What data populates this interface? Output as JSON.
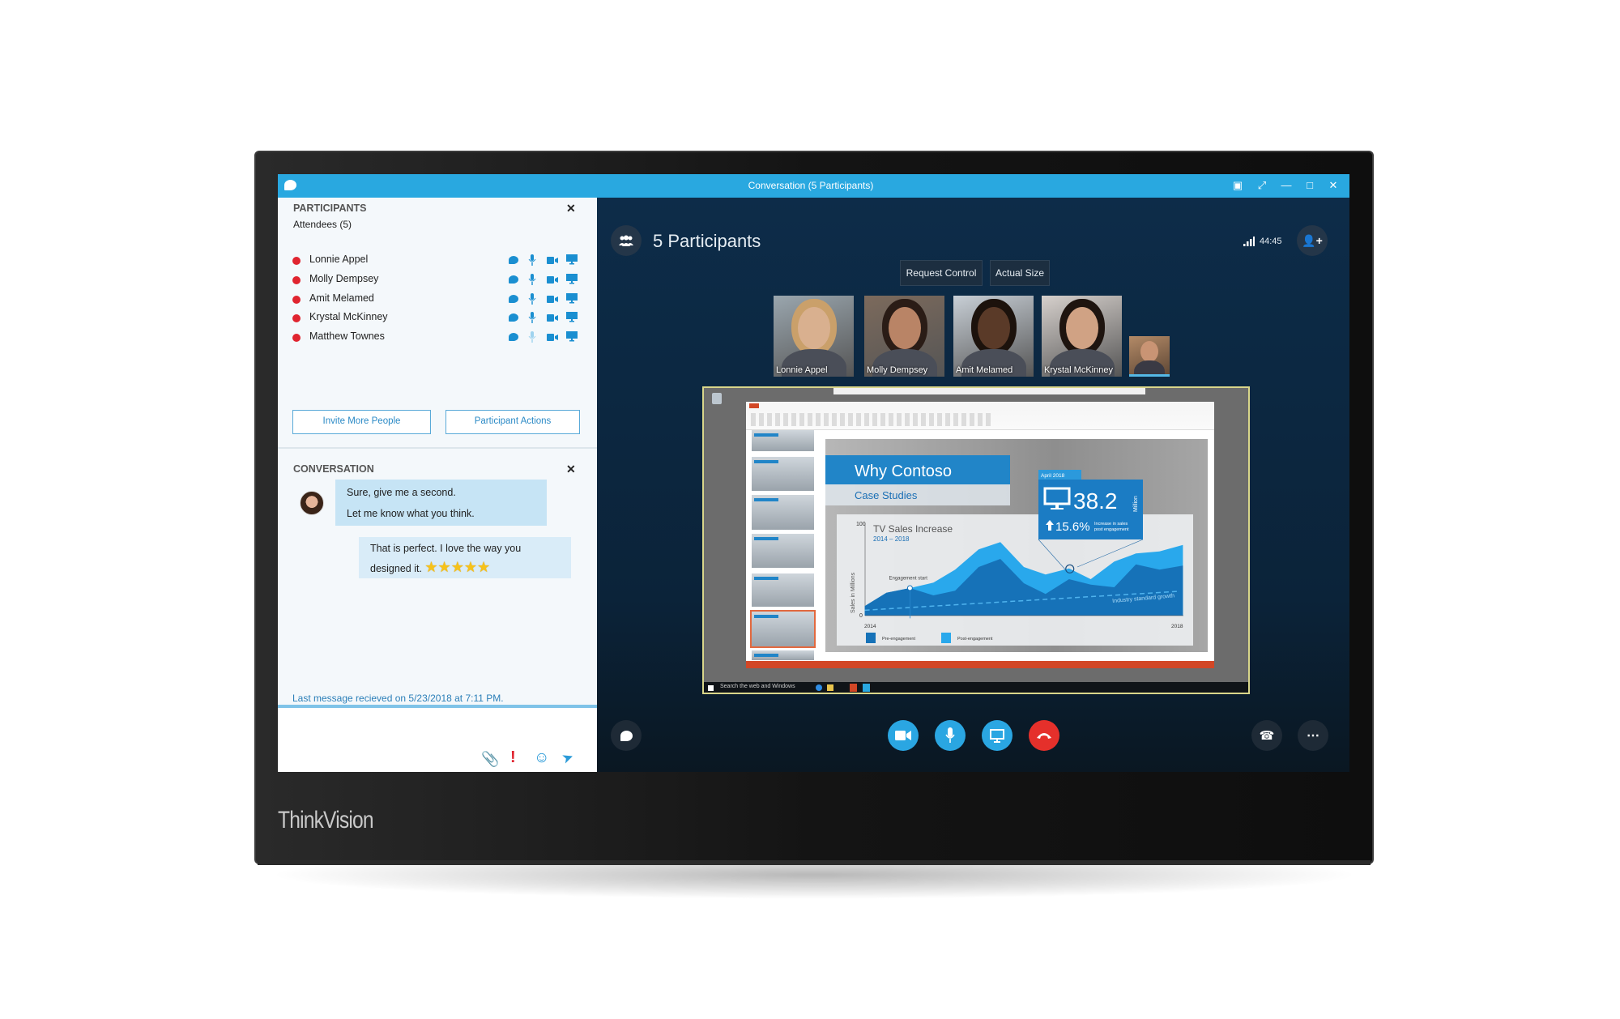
{
  "brand": "ThinkVision",
  "window": {
    "title": "Conversation (5 Participants)"
  },
  "participants_panel": {
    "heading": "PARTICIPANTS",
    "attendees_label": "Attendees (5)",
    "people": [
      {
        "name": "Lonnie Appel",
        "status_color": "#e0242f",
        "mic_muted": false
      },
      {
        "name": "Molly Dempsey",
        "status_color": "#e0242f",
        "mic_muted": false
      },
      {
        "name": "Amit Melamed",
        "status_color": "#e0242f",
        "mic_muted": false
      },
      {
        "name": "Krystal McKinney",
        "status_color": "#e0242f",
        "mic_muted": false
      },
      {
        "name": "Matthew Townes",
        "status_color": "#e0242f",
        "mic_muted": true
      }
    ],
    "invite_button": "Invite More People",
    "actions_button": "Participant Actions"
  },
  "conversation_panel": {
    "heading": "CONVERSATION",
    "messages": [
      {
        "from": "other",
        "lines": [
          "Sure, give me a second.",
          "Let me know what you think."
        ]
      },
      {
        "from": "me",
        "lines": [
          "That is perfect. I love the way you",
          "designed it."
        ],
        "stars": 5
      }
    ],
    "last_message": "Last message recieved on 5/23/2018 at 7:11 PM.",
    "input_value": ""
  },
  "stage": {
    "participants_title": "5 Participants",
    "call_timer": "44:45",
    "request_control": "Request Control",
    "actual_size": "Actual Size",
    "video_tiles": [
      "Lonnie Appel",
      "Molly Dempsey",
      "Amit Melamed",
      "Krystal McKinney"
    ],
    "self_view": true
  },
  "shared_screen": {
    "taskbar_search": "Search the web and Windows",
    "slide": {
      "title": "Why Contoso",
      "subtitle": "Case Studies",
      "stat_tab": "April 2018",
      "stat_value": "38.2",
      "stat_unit": "Million",
      "stat_change": "15.6%",
      "stat_note_1": "Increase in sales",
      "stat_note_2": "post engagement",
      "chart_title": "TV Sales Increase",
      "chart_range": "2014 – 2018",
      "y_label": "Sales in Millions",
      "y_max": "100",
      "y_min": "0",
      "x_start": "2014",
      "x_end": "2018",
      "annotation": "Engagement start",
      "trend_label": "Industry standard growth",
      "legend": [
        "Pre-engagement",
        "Post-engagement"
      ]
    }
  },
  "colors": {
    "accent": "#29a8e0",
    "end_call": "#e5302b",
    "status_busy": "#e0242f",
    "icon_blue": "#1a8fd1"
  }
}
